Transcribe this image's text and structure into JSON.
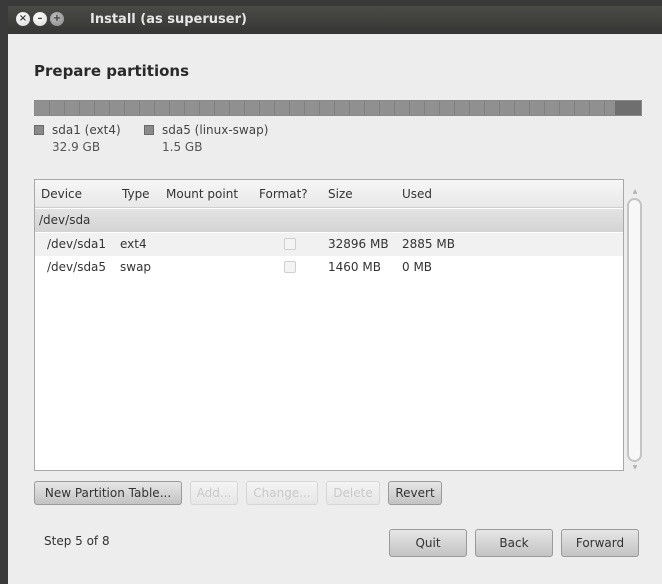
{
  "window": {
    "title": "Install (as superuser)"
  },
  "page": {
    "title": "Prepare partitions"
  },
  "partitions_legend": [
    {
      "name": "sda1 (ext4)",
      "size": "32.9 GB",
      "size_gb": 32.9
    },
    {
      "name": "sda5 (linux-swap)",
      "size": "1.5 GB",
      "size_gb": 1.5
    }
  ],
  "table": {
    "columns": [
      "Device",
      "Type",
      "Mount point",
      "Format?",
      "Size",
      "Used"
    ],
    "group": "/dev/sda",
    "rows": [
      {
        "device": "/dev/sda1",
        "type": "ext4",
        "mount": "",
        "format": false,
        "size": "32896 MB",
        "used": "2885 MB"
      },
      {
        "device": "/dev/sda5",
        "type": "swap",
        "mount": "",
        "format": false,
        "size": "1460 MB",
        "used": "0 MB"
      }
    ]
  },
  "actions": {
    "new_table": "New Partition Table...",
    "add": "Add...",
    "change": "Change...",
    "delete": "Delete",
    "revert": "Revert"
  },
  "footer": {
    "step": "Step 5 of 8",
    "quit": "Quit",
    "back": "Back",
    "forward": "Forward"
  },
  "icons": {
    "close": "close-icon",
    "minimize": "minimize-icon",
    "maximize": "maximize-icon"
  }
}
